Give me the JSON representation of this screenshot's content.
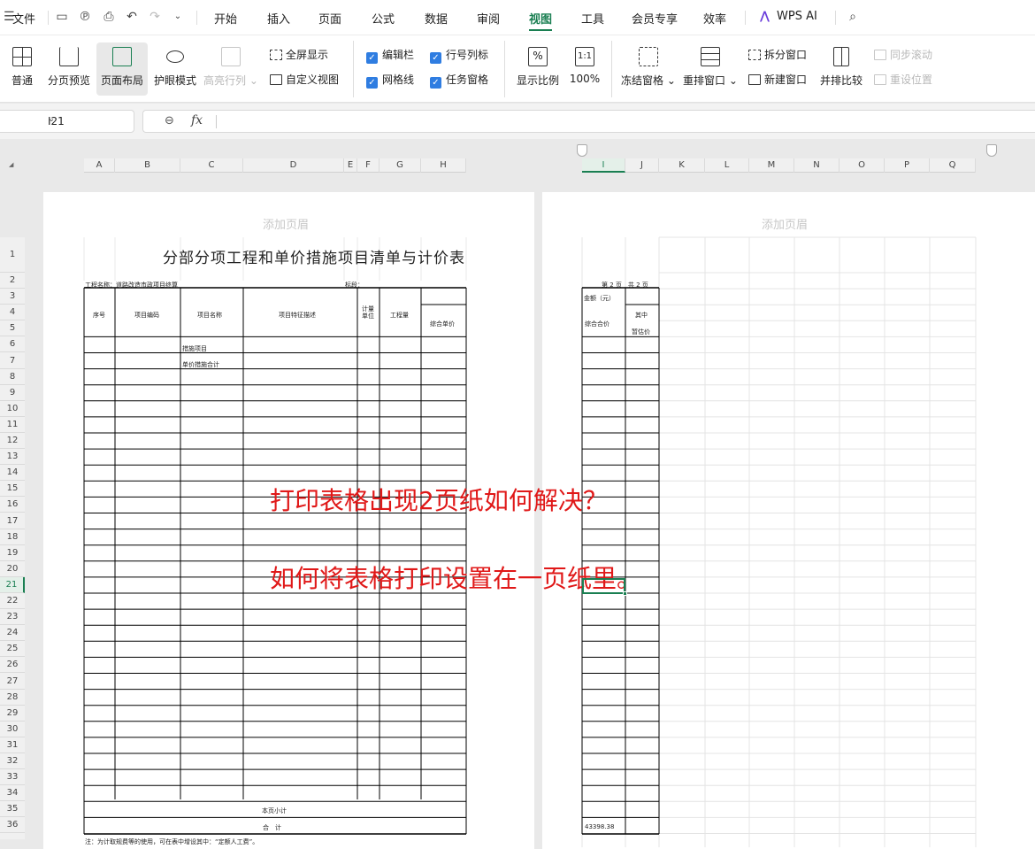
{
  "menubar": {
    "file": "文件",
    "tabs": [
      "开始",
      "插入",
      "页面",
      "公式",
      "数据",
      "审阅",
      "视图",
      "工具",
      "会员专享",
      "效率"
    ],
    "active_tab": "视图",
    "wps_ai": "WPS AI"
  },
  "ribbon": {
    "normal": "普通",
    "page_break_preview": "分页预览",
    "page_layout": "页面布局",
    "eye_protection": "护眼模式",
    "highlight_rowcol": "高亮行列",
    "full_screen": "全屏显示",
    "custom_view": "自定义视图",
    "edit_bar": "编辑栏",
    "row_col_headers": "行号列标",
    "gridlines": "网格线",
    "task_pane": "任务窗格",
    "zoom": "显示比例",
    "zoom_100": "100%",
    "freeze_panes": "冻结窗格",
    "arrange_windows": "重排窗口",
    "split_window": "拆分窗口",
    "new_window": "新建窗口",
    "side_by_side": "并排比较",
    "sync_scroll": "同步滚动",
    "reset_position": "重设位置"
  },
  "formula_bar": {
    "cell_ref": "I21",
    "fx": "fx",
    "formula": ""
  },
  "columns_left": [
    "A",
    "B",
    "C",
    "D",
    "E",
    "F",
    "G",
    "H"
  ],
  "columns_right": [
    "I",
    "J",
    "K",
    "L",
    "M",
    "N",
    "O",
    "P",
    "Q"
  ],
  "selected_column": "I",
  "selected_row": "21",
  "rows": [
    "1",
    "2",
    "3",
    "4",
    "5",
    "6",
    "7",
    "8",
    "9",
    "10",
    "11",
    "12",
    "13",
    "14",
    "15",
    "16",
    "17",
    "18",
    "19",
    "20",
    "21",
    "22",
    "23",
    "24",
    "25",
    "26",
    "27",
    "28",
    "29",
    "30",
    "31",
    "32",
    "33",
    "34",
    "35",
    "36"
  ],
  "page_header_placeholder": "添加页眉",
  "sheet": {
    "title": "分部分项工程和单价措施项目清单与计价表",
    "project_name": "工程名称：道路改造市政项目终算",
    "section": "标段：",
    "page_of": "第 2 页　共 2 页",
    "amount_unit": "金额（元）",
    "col_no": "序号",
    "col_code": "项目编码",
    "col_name": "项目名称",
    "col_feature": "项目特征描述",
    "col_unit": "计量单位",
    "col_qty": "工程量",
    "col_unit_price": "综合单价",
    "col_total": "综合合价",
    "col_among": "其中",
    "col_estimate": "暂估价",
    "row6_name": "措施项目",
    "row7_name": "单价措施合计",
    "subtotal": "本页小计",
    "total": "合　计",
    "total_value": "43398.38",
    "note": "注：为计取规费等的使用，可在表中增设其中：“定额人工费”。"
  },
  "overlay": {
    "line1": "打印表格出现2页纸如何解决？",
    "line2": "如何将表格打印设置在一页纸里。"
  }
}
